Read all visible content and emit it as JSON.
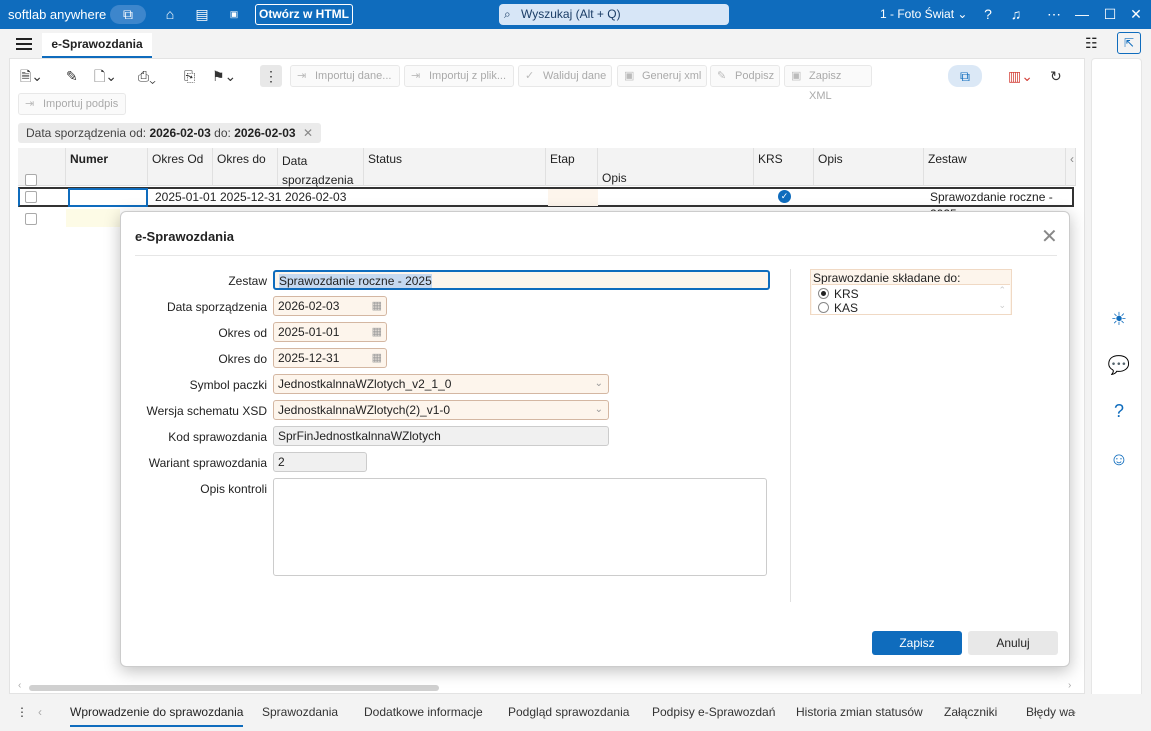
{
  "titlebar": {
    "brand": "softlab anywhere",
    "open_html": "Otwórz w HTML",
    "search_placeholder": "Wyszukaj (Alt + Q)",
    "company": "1 - Foto Świat"
  },
  "tab": {
    "active": "e-Sprawozdania"
  },
  "toolbar": {
    "import_data": "Importuj dane...",
    "import_file": "Importuj z plik...",
    "validate": "Waliduj dane",
    "generate_xml": "Generuj xml",
    "sign": "Podpisz",
    "save_xml": "Zapisz XML",
    "import_sign": "Importuj podpis"
  },
  "filter": {
    "label": "Data sporządzenia",
    "from_label": "od:",
    "from": "2026-02-03",
    "to_label": "do:",
    "to": "2026-02-03"
  },
  "grid": {
    "columns": [
      "Numer",
      "Okres Od",
      "Okres do",
      "Data",
      "sporządzenia",
      "Status",
      "Etap",
      "Opis",
      "KRS",
      "Opis",
      "Zestaw"
    ],
    "row": {
      "okres_od": "2025-01-01",
      "okres_do": "2025-12-31",
      "data": "2026-02-03",
      "zestaw": "Sprawozdanie roczne  - 2025"
    }
  },
  "modal": {
    "title": "e-Sprawozdania",
    "labels": {
      "zestaw": "Zestaw",
      "data": "Data sporządzenia",
      "okres_od": "Okres od",
      "okres_do": "Okres do",
      "symbol": "Symbol paczki",
      "wersja": "Wersja schematu XSD",
      "kod": "Kod sprawozdania",
      "wariant": "Wariant sprawozdania",
      "opis": "Opis kontroli"
    },
    "values": {
      "zestaw": "Sprawozdanie roczne  - 2025",
      "data": "2026-02-03",
      "okres_od": "2025-01-01",
      "okres_do": "2025-12-31",
      "symbol": "JednostkalnnaWZlotych_v2_1_0",
      "wersja": "JednostkalnnaWZlotych(2)_v1-0",
      "kod": "SprFinJednostkalnnaWZlotych",
      "wariant": "2"
    },
    "group": {
      "title": "Sprawozdanie składane do:",
      "opt1": "KRS",
      "opt2": "KAS"
    },
    "save": "Zapisz",
    "cancel": "Anuluj"
  },
  "bottom_tabs": [
    "Wprowadzenie do sprawozdania",
    "Sprawozdania",
    "Dodatkowe informacje",
    "Podgląd sprawozdania",
    "Podpisy e-Sprawozdań",
    "Historia zmian statusów",
    "Załączniki",
    "Błędy wa"
  ]
}
